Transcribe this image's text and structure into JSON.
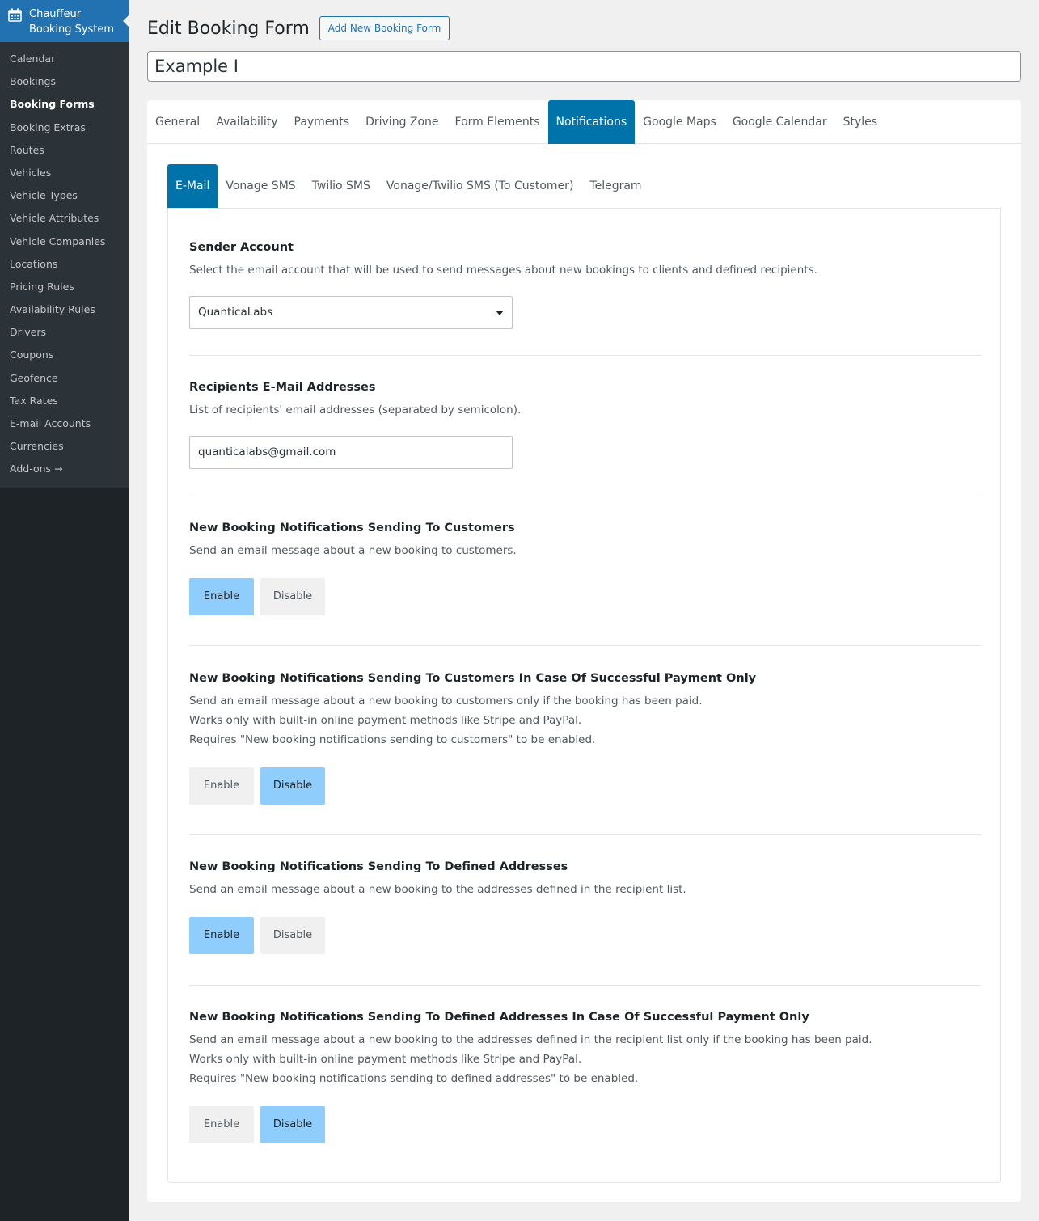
{
  "sidebar": {
    "app_title_line1": "Chauffeur",
    "app_title_line2": "Booking System",
    "icon": "calendar-icon",
    "items": [
      {
        "label": "Calendar"
      },
      {
        "label": "Bookings"
      },
      {
        "label": "Booking Forms",
        "active": true
      },
      {
        "label": "Booking Extras"
      },
      {
        "label": "Routes"
      },
      {
        "label": "Vehicles"
      },
      {
        "label": "Vehicle Types"
      },
      {
        "label": "Vehicle Attributes"
      },
      {
        "label": "Vehicle Companies"
      },
      {
        "label": "Locations"
      },
      {
        "label": "Pricing Rules"
      },
      {
        "label": "Availability Rules"
      },
      {
        "label": "Drivers"
      },
      {
        "label": "Coupons"
      },
      {
        "label": "Geofence"
      },
      {
        "label": "Tax Rates"
      },
      {
        "label": "E-mail Accounts"
      },
      {
        "label": "Currencies"
      },
      {
        "label": "Add-ons →"
      }
    ]
  },
  "header": {
    "title": "Edit Booking Form",
    "add_button": "Add New Booking Form",
    "form_name": "Example I"
  },
  "main_tabs": [
    "General",
    "Availability",
    "Payments",
    "Driving Zone",
    "Form Elements",
    "Notifications",
    "Google Maps",
    "Google Calendar",
    "Styles"
  ],
  "main_tab_active": "Notifications",
  "sub_tabs": [
    "E-Mail",
    "Vonage SMS",
    "Twilio SMS",
    "Vonage/Twilio SMS (To Customer)",
    "Telegram"
  ],
  "sub_tab_active": "E-Mail",
  "sections": {
    "sender": {
      "title": "Sender Account",
      "desc": "Select the email account that will be used to send messages about new bookings to clients and defined recipients.",
      "selected": "QuanticaLabs"
    },
    "recipients": {
      "title": "Recipients E-Mail Addresses",
      "desc": "List of recipients' email addresses (separated by semicolon).",
      "value": "quanticalabs@gmail.com"
    },
    "to_customers": {
      "title": "New Booking Notifications Sending To Customers",
      "desc": "Send an email message about a new booking to customers.",
      "enable": "Enable",
      "disable": "Disable",
      "state": "enable"
    },
    "to_customers_paid": {
      "title": "New Booking Notifications Sending To Customers In Case Of Successful Payment Only",
      "desc1": "Send an email message about a new booking to customers only if the booking has been paid.",
      "desc2": "Works only with built-in online payment methods like Stripe and PayPal.",
      "desc3": "Requires \"New booking notifications sending to customers\" to be enabled.",
      "enable": "Enable",
      "disable": "Disable",
      "state": "disable"
    },
    "to_defined": {
      "title": "New Booking Notifications Sending To Defined Addresses",
      "desc": "Send an email message about a new booking to the addresses defined in the recipient list.",
      "enable": "Enable",
      "disable": "Disable",
      "state": "enable"
    },
    "to_defined_paid": {
      "title": "New Booking Notifications Sending To Defined Addresses In Case Of Successful Payment Only",
      "desc1": "Send an email message about a new booking to the addresses defined in the recipient list only if the booking has been paid.",
      "desc2": "Works only with built-in online payment methods like Stripe and PayPal.",
      "desc3": "Requires \"New booking notifications sending to defined addresses\" to be enabled.",
      "enable": "Enable",
      "disable": "Disable",
      "state": "disable"
    }
  },
  "colors": {
    "accent": "#0073aa",
    "toggle_on": "#8fcdfd",
    "sidebar_bg": "#1d2327",
    "sidebar_head": "#2271b1"
  }
}
